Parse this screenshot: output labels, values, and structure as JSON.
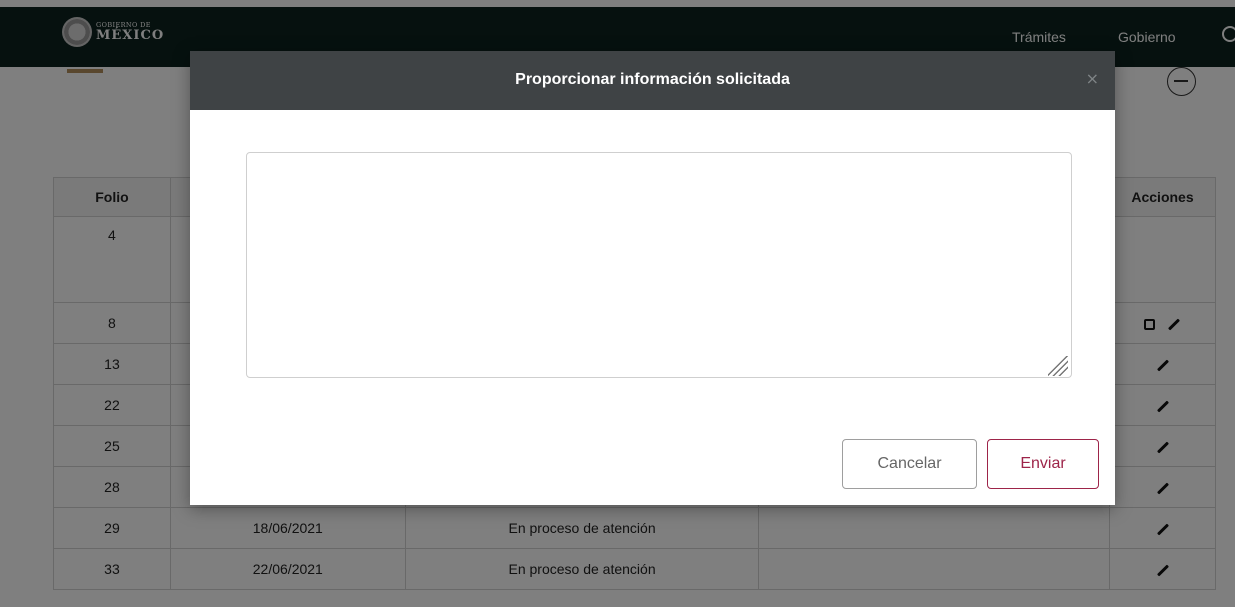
{
  "header": {
    "logo_small": "GOBIERNO DE",
    "logo_big": "MÉXICO",
    "nav": [
      "Trámites",
      "Gobierno"
    ],
    "search_icon": "search-icon"
  },
  "table": {
    "headers": [
      "Folio",
      "",
      "",
      "",
      "Acciones"
    ],
    "rows": [
      {
        "folio": "4",
        "fecha": "",
        "estatus": "",
        "actions": []
      },
      {
        "folio": "8",
        "fecha": "",
        "estatus": "",
        "actions": [
          "edit-box-icon",
          "pencil-icon"
        ]
      },
      {
        "folio": "13",
        "fecha": "",
        "estatus": "",
        "actions": [
          "pencil-icon"
        ]
      },
      {
        "folio": "22",
        "fecha": "",
        "estatus": "",
        "actions": [
          "pencil-icon"
        ]
      },
      {
        "folio": "25",
        "fecha": "",
        "estatus": "",
        "actions": [
          "pencil-icon"
        ]
      },
      {
        "folio": "28",
        "fecha": "",
        "estatus": "",
        "actions": [
          "pencil-icon"
        ]
      },
      {
        "folio": "29",
        "fecha": "18/06/2021",
        "estatus": "En proceso de atención",
        "actions": [
          "pencil-icon"
        ]
      },
      {
        "folio": "33",
        "fecha": "22/06/2021",
        "estatus": "En proceso de atención",
        "actions": [
          "pencil-icon"
        ]
      }
    ]
  },
  "modal": {
    "title": "Proporcionar información solicitada",
    "close_label": "×",
    "textarea_value": "",
    "cancel_label": "Cancelar",
    "send_label": "Enviar"
  },
  "colors": {
    "header_bg": "#0c231e",
    "modal_header_bg": "#3f4345",
    "accent": "#9d2449",
    "gold": "#b38e5d"
  }
}
